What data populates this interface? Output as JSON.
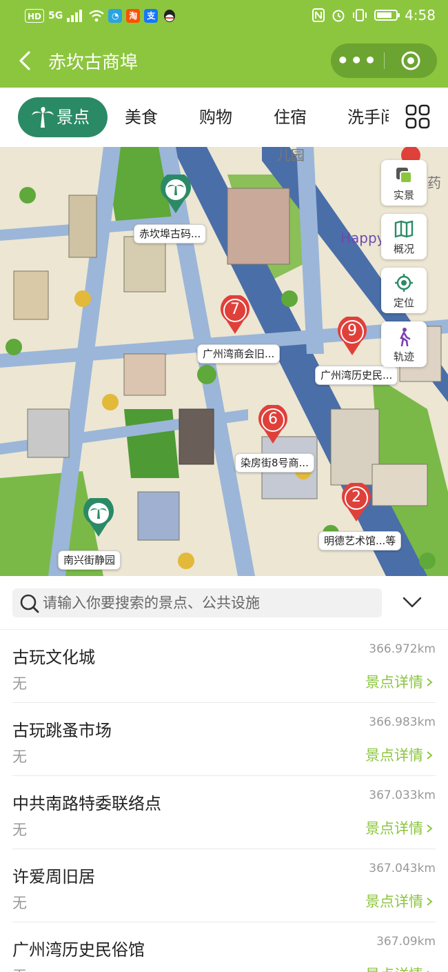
{
  "status_bar": {
    "hd": "HD",
    "signal": "5G",
    "time": "4:58",
    "battery_level": 0.8,
    "app_badges": [
      {
        "label": "淘",
        "color": "#ff5000"
      },
      {
        "label": "支",
        "color": "#1677ff"
      }
    ]
  },
  "nav": {
    "title": "赤坎古商埠",
    "more": "•••"
  },
  "tabs": {
    "items": [
      "景点",
      "美食",
      "购物",
      "住宿",
      "洗手间"
    ],
    "active_index": 0
  },
  "map": {
    "background_texts": [
      "儿园",
      "药",
      "Happy"
    ],
    "park_markers": [
      {
        "label": "赤坎埠古码..."
      },
      {
        "label": "南兴街静园"
      }
    ],
    "numbered_markers": [
      {
        "number": "7",
        "label": "广州湾商会旧..."
      },
      {
        "number": "9",
        "label": "广州湾历史民..."
      },
      {
        "number": "6",
        "label": "染房街8号商..."
      },
      {
        "number": "2",
        "label": "明德艺术馆...等"
      }
    ],
    "tools": [
      {
        "label": "实景",
        "icon": "layers-icon"
      },
      {
        "label": "概况",
        "icon": "map-book-icon"
      },
      {
        "label": "定位",
        "icon": "locate-icon"
      },
      {
        "label": "轨迹",
        "icon": "walker-icon"
      }
    ]
  },
  "search": {
    "placeholder": "请输入你要搜索的景点、公共设施"
  },
  "list": [
    {
      "name": "古玩文化城",
      "sub": "无",
      "distance": "366.972km",
      "detail": "景点详情"
    },
    {
      "name": "古玩跳蚤市场",
      "sub": "无",
      "distance": "366.983km",
      "detail": "景点详情"
    },
    {
      "name": "中共南路特委联络点",
      "sub": "无",
      "distance": "367.033km",
      "detail": "景点详情"
    },
    {
      "name": "许爱周旧居",
      "sub": "无",
      "distance": "367.043km",
      "detail": "景点详情"
    },
    {
      "name": "广州湾历史民俗馆",
      "sub": "无",
      "distance": "367.09km",
      "detail": "景点详情"
    }
  ],
  "colors": {
    "brand_green": "#8cc63e",
    "tab_active": "#2b8a66",
    "pin_red": "#e0403a"
  }
}
